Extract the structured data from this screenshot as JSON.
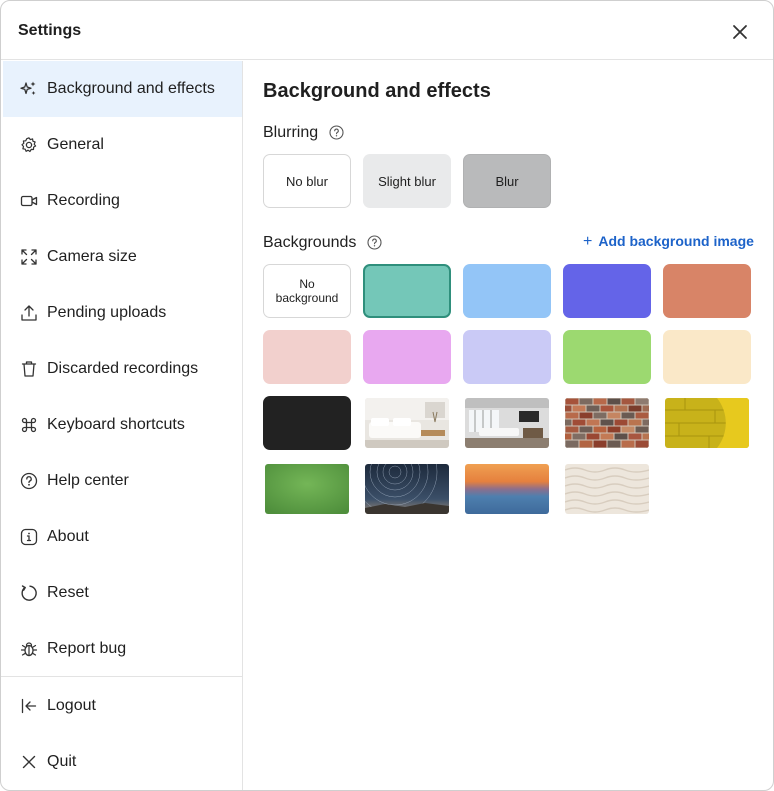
{
  "window": {
    "title": "Settings"
  },
  "sidebar": {
    "items": [
      {
        "label": "Background and effects",
        "icon": "sparkles-icon",
        "active": true
      },
      {
        "label": "General",
        "icon": "gear-icon"
      },
      {
        "label": "Recording",
        "icon": "video-camera-icon"
      },
      {
        "label": "Camera size",
        "icon": "expand-icon"
      },
      {
        "label": "Pending uploads",
        "icon": "upload-icon"
      },
      {
        "label": "Discarded recordings",
        "icon": "trash-icon"
      },
      {
        "label": "Keyboard shortcuts",
        "icon": "command-icon"
      },
      {
        "label": "Help center",
        "icon": "question-circle-icon"
      },
      {
        "label": "About",
        "icon": "info-icon"
      },
      {
        "label": "Reset",
        "icon": "reset-icon"
      },
      {
        "label": "Report bug",
        "icon": "bug-icon"
      },
      {
        "label": "Logout",
        "icon": "logout-icon"
      },
      {
        "label": "Quit",
        "icon": "close-icon"
      }
    ]
  },
  "main": {
    "title": "Background and effects",
    "blurring": {
      "label": "Blurring",
      "options": [
        {
          "label": "No blur",
          "bg": "#ffffff",
          "border": "#d7d7d7"
        },
        {
          "label": "Slight blur",
          "bg": "#e9eaeb",
          "border": "#e9eaeb"
        },
        {
          "label": "Blur",
          "bg": "#b9babb",
          "border": "#b0b1b2"
        }
      ]
    },
    "backgrounds": {
      "label": "Backgrounds",
      "add_label": "Add background image",
      "no_background_label": "No background",
      "colors": [
        "#74c7b8",
        "#93c5f7",
        "#6464e8",
        "#d88467",
        "#f2d0cd",
        "#e8a8f0",
        "#cacaf6",
        "#9cd970",
        "#fae8c8",
        "#222222"
      ],
      "selected_color": "#74c7b8",
      "photos": [
        "living-room",
        "office-room",
        "brick-wall",
        "yellow-wall",
        "green-grass",
        "star-trails",
        "sunset-sea",
        "white-wave-panel"
      ]
    }
  }
}
